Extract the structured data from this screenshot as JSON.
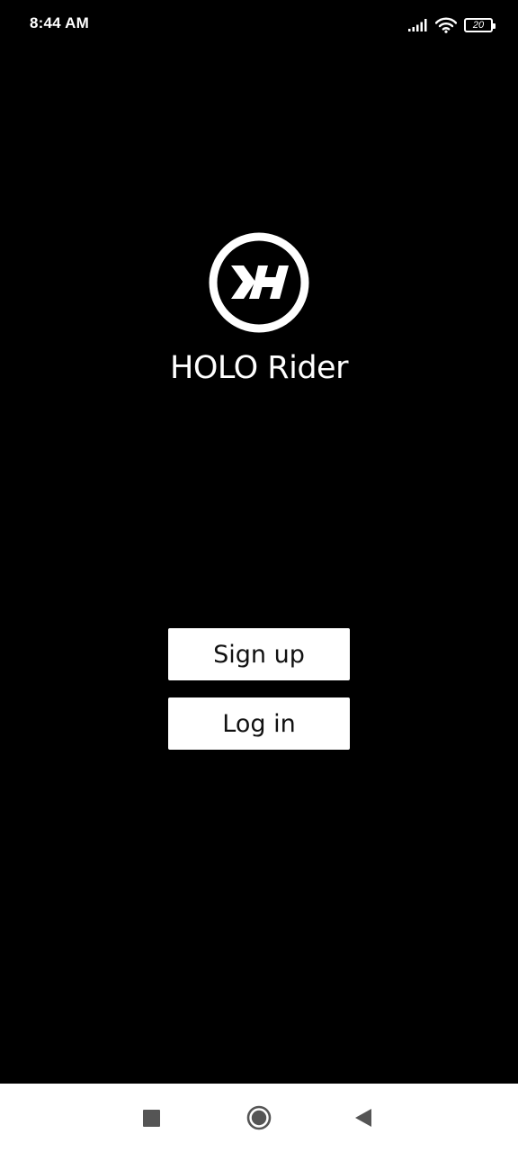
{
  "status_bar": {
    "time": "8:44 AM",
    "battery_level": "20",
    "icons": [
      "signal-icon",
      "wifi-icon",
      "battery-icon"
    ]
  },
  "app": {
    "logo": "holo-rider-logo",
    "title": "HOLO Rider"
  },
  "auth": {
    "signup_label": "Sign up",
    "login_label": "Log in"
  },
  "nav_bar": {
    "icons": [
      "recent-apps-icon",
      "home-icon",
      "back-icon"
    ]
  },
  "colors": {
    "background": "#000000",
    "foreground": "#ffffff",
    "button_text": "#111111",
    "nav_icon": "#555555"
  }
}
